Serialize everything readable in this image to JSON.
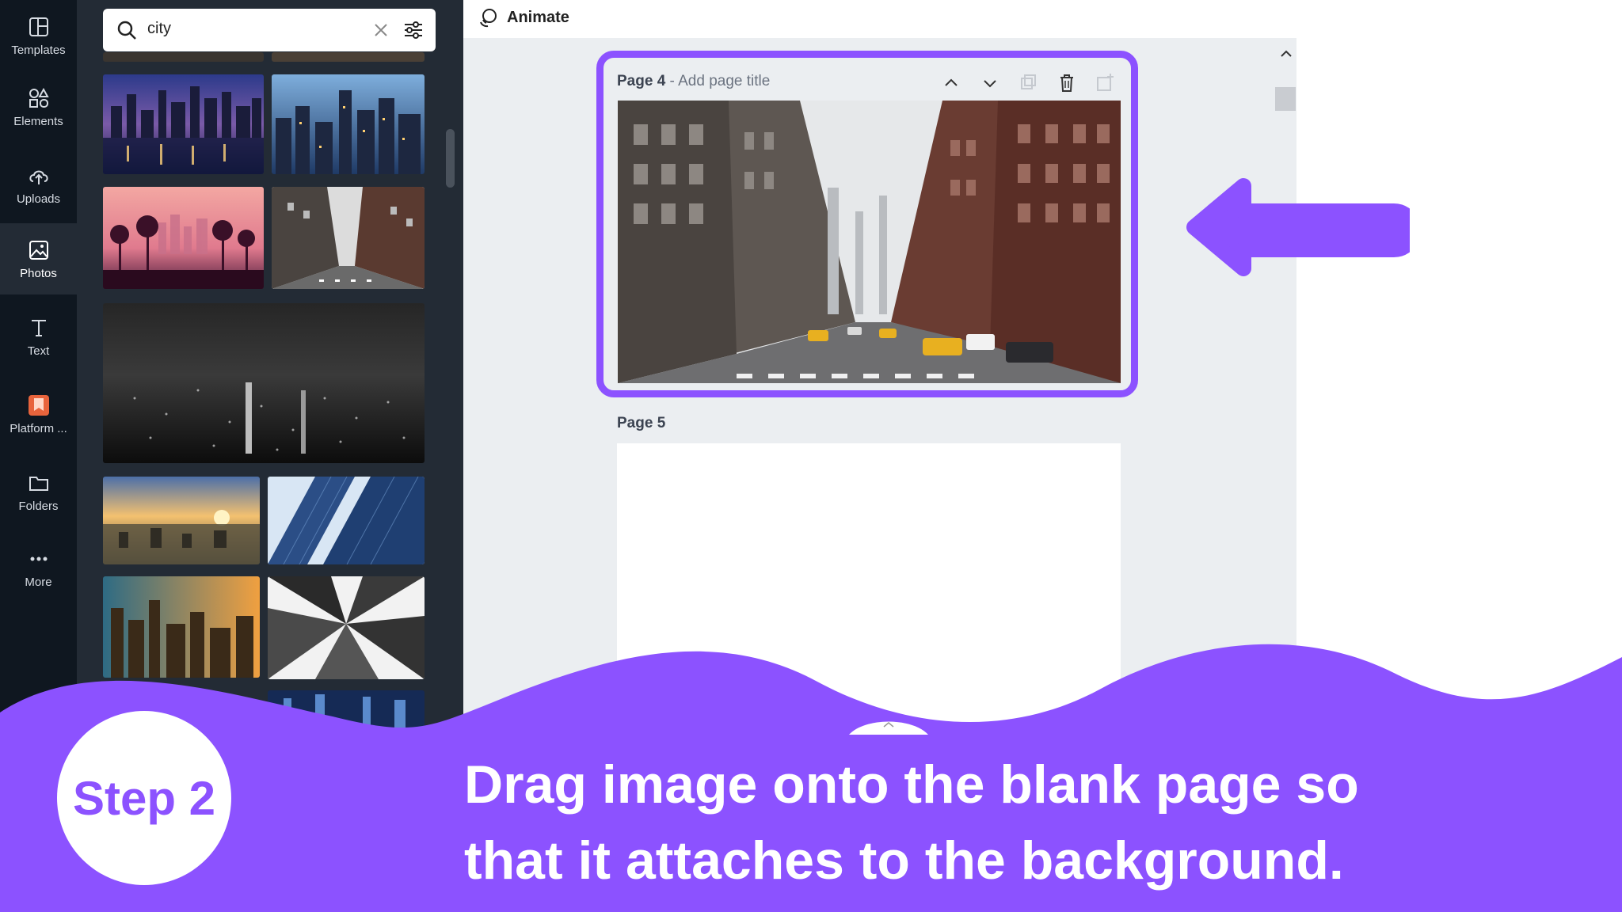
{
  "rail": {
    "items": [
      {
        "label": "Templates",
        "icon": "templates-icon"
      },
      {
        "label": "Elements",
        "icon": "elements-icon"
      },
      {
        "label": "Uploads",
        "icon": "upload-icon"
      },
      {
        "label": "Photos",
        "icon": "photos-icon"
      },
      {
        "label": "Text",
        "icon": "text-icon"
      },
      {
        "label": "Platform ...",
        "icon": "platform-icon"
      },
      {
        "label": "Folders",
        "icon": "folder-icon"
      },
      {
        "label": "More",
        "icon": "more-icon"
      }
    ],
    "active": "Photos"
  },
  "search": {
    "query": "city"
  },
  "toolbar": {
    "animate_label": "Animate"
  },
  "pages": {
    "page4": {
      "title": "Page 4",
      "subtitle": " - Add page title"
    },
    "page5": {
      "title": "Page 5"
    }
  },
  "tutorial": {
    "step_label": "Step 2",
    "line1": "Drag image onto the blank page so",
    "line2": "that it attaches to the background.",
    "accent_color": "#8c52ff"
  }
}
